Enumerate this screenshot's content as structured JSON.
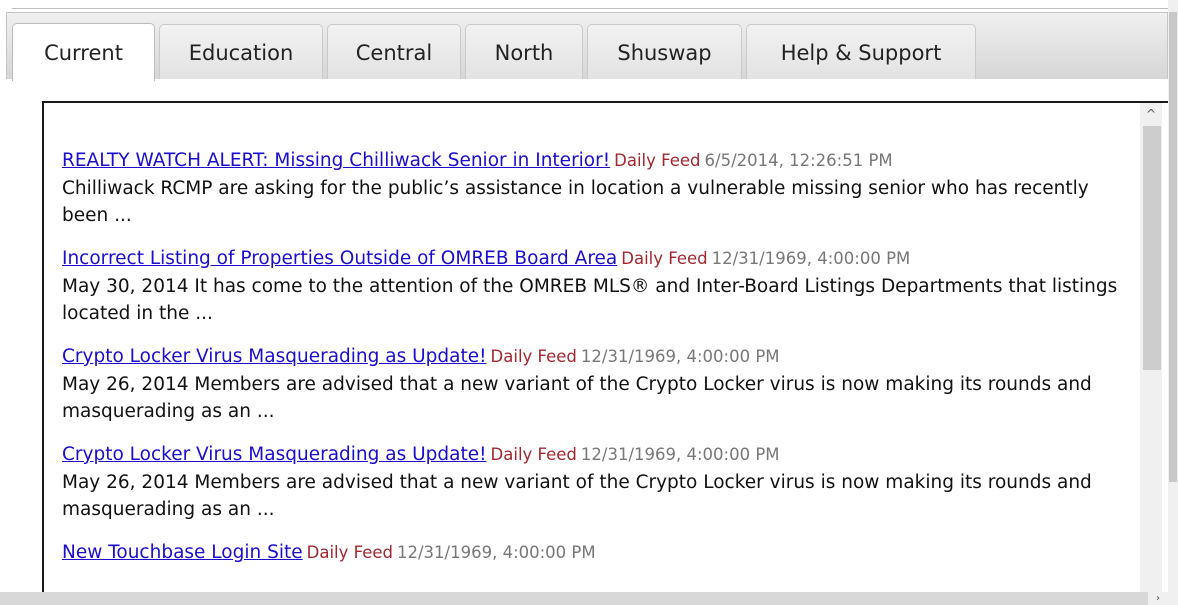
{
  "tabs": [
    {
      "label": "Current",
      "active": true
    },
    {
      "label": "Education",
      "active": false
    },
    {
      "label": "Central",
      "active": false
    },
    {
      "label": "North",
      "active": false
    },
    {
      "label": "Shuswap",
      "active": false
    },
    {
      "label": "Help & Support",
      "active": false
    }
  ],
  "feed": [
    {
      "title": "REALTY WATCH ALERT: Missing Chilliwack Senior in Interior!",
      "source": "Daily Feed",
      "date": "6/5/2014, 12:26:51 PM",
      "snippet": "Chilliwack RCMP are asking for the public’s assistance in location a vulnerable missing senior who has recently been ..."
    },
    {
      "title": "Incorrect Listing of Properties Outside of OMREB Board Area",
      "source": "Daily Feed",
      "date": "12/31/1969, 4:00:00 PM",
      "snippet": "May 30, 2014 It has come to the attention of the OMREB MLS® and Inter-Board Listings Departments that listings located in the ..."
    },
    {
      "title": "Crypto Locker Virus Masquerading as Update!",
      "source": "Daily Feed",
      "date": "12/31/1969, 4:00:00 PM",
      "snippet": "May 26, 2014 Members are advised that a new variant of the Crypto Locker virus is now making its rounds and masquerading as an ..."
    },
    {
      "title": "Crypto Locker Virus Masquerading as Update!",
      "source": "Daily Feed",
      "date": "12/31/1969, 4:00:00 PM",
      "snippet": "May 26, 2014 Members are advised that a new variant of the Crypto Locker virus is now making its rounds and masquerading as an ..."
    },
    {
      "title": "New Touchbase Login Site",
      "source": "Daily Feed",
      "date": "12/31/1969, 4:00:00 PM",
      "snippet": ""
    }
  ],
  "scrollbar": {
    "up_glyph": "^",
    "down_glyph": "›"
  },
  "colors": {
    "link": "#1a0dcc",
    "source": "#a0272f",
    "date": "#777777"
  }
}
